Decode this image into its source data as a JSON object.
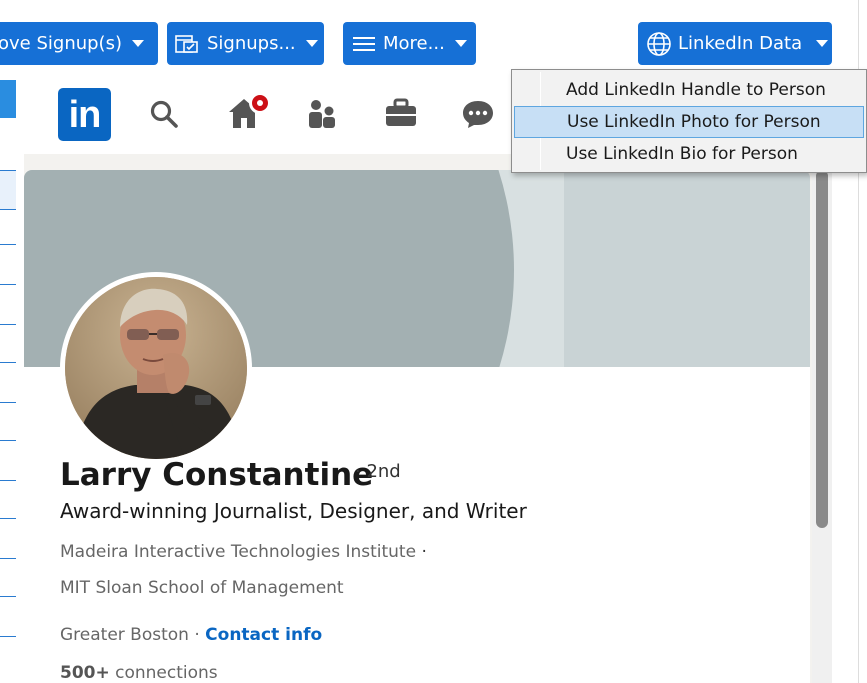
{
  "toolbar": {
    "remove_signup_label": "ove Signup(s)",
    "signups_label": "Signups...",
    "more_label": "More...",
    "linkedin_label": "LinkedIn Data"
  },
  "menu": {
    "items": [
      {
        "label": "Add LinkedIn Handle to Person",
        "highlighted": false
      },
      {
        "label": "Use LinkedIn Photo for Person",
        "highlighted": true
      },
      {
        "label": "Use LinkedIn Bio for Person",
        "highlighted": false
      }
    ]
  },
  "linkedin": {
    "logo_text": "in",
    "nav_icons": [
      "search-icon",
      "home-icon",
      "people-icon",
      "briefcase-icon",
      "messaging-icon"
    ],
    "notification_badge": true
  },
  "profile": {
    "name": "Larry Constantine",
    "degree": "· 2nd",
    "headline": "Award-winning Journalist, Designer, and Writer",
    "org1": "Madeira Interactive Technologies Institute",
    "org1_sep": "·",
    "org2": "MIT Sloan School of Management",
    "location": "Greater Boston",
    "location_sep": " · ",
    "contact_info": "Contact info",
    "connections_count": "500+",
    "connections_label": " connections"
  },
  "colors": {
    "toolbar_blue": "#1670d6",
    "linkedin_blue": "#0a66c2",
    "menu_highlight": "#c7dff5",
    "badge_red": "#cc1016"
  }
}
